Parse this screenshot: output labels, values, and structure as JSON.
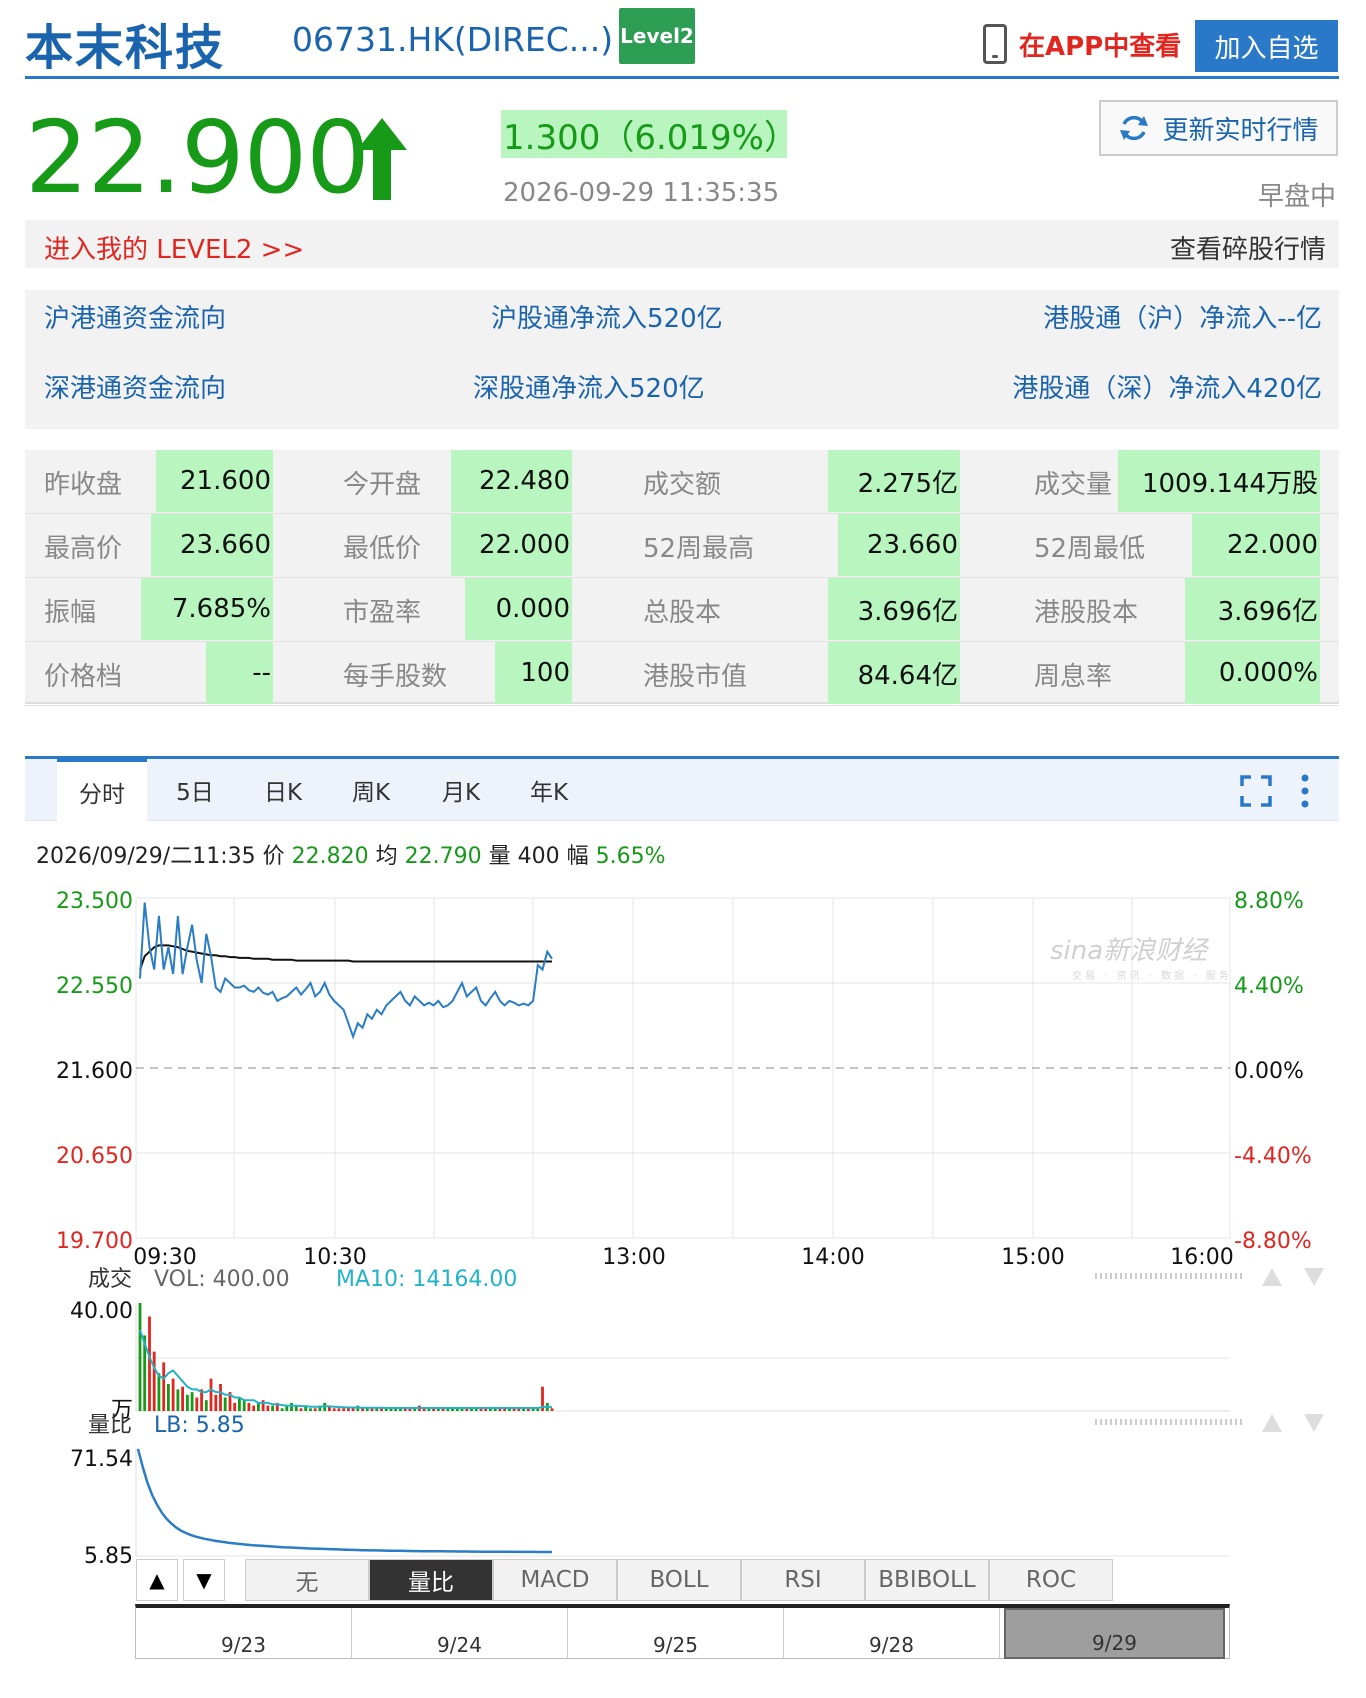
{
  "header": {
    "stock_name": "本末科技",
    "stock_code": "06731.HK(DIREC...)",
    "level2_badge": "Level2",
    "app_link": "在APP中查看",
    "add_fav": "加入自选"
  },
  "quote": {
    "price": "22.900",
    "change": "1.300（6.019%）",
    "timestamp": "2026-09-29 11:35:35",
    "refresh_label": "更新实时行情",
    "market_status": "早盘中",
    "level2_link": "进入我的 LEVEL2 >>",
    "odd_lot": "查看碎股行情"
  },
  "flows": {
    "sh_flow": "沪港通资金流向",
    "sh_north": "沪股通净流入520亿",
    "sh_south": "港股通（沪）净流入--亿",
    "sz_flow": "深港通资金流向",
    "sz_north": "深股通净流入520亿",
    "sz_south": "港股通（深）净流入420亿"
  },
  "stats": [
    [
      [
        "昨收盘",
        "21.600"
      ],
      [
        "今开盘",
        "22.480"
      ],
      [
        "成交额",
        "2.275亿"
      ],
      [
        "成交量",
        "1009.144万股"
      ]
    ],
    [
      [
        "最高价",
        "23.660"
      ],
      [
        "最低价",
        "22.000"
      ],
      [
        "52周最高",
        "23.660"
      ],
      [
        "52周最低",
        "22.000"
      ]
    ],
    [
      [
        "振幅",
        "7.685%"
      ],
      [
        "市盈率",
        "0.000"
      ],
      [
        "总股本",
        "3.696亿"
      ],
      [
        "港股股本",
        "3.696亿"
      ]
    ],
    [
      [
        "价格档",
        "--"
      ],
      [
        "每手股数",
        "100"
      ],
      [
        "港股市值",
        "84.64亿"
      ],
      [
        "周息率",
        "0.000%"
      ]
    ]
  ],
  "tabs": [
    "分时",
    "5日",
    "日K",
    "周K",
    "月K",
    "年K"
  ],
  "hover": {
    "date": "2026/09/29/二11:35",
    "price_label": "价",
    "price": "22.820",
    "avg_label": "均",
    "avg": "22.790",
    "vol_label": "量",
    "vol": "400",
    "amp_label": "幅",
    "amp": "5.65%"
  },
  "watermark": {
    "logo": "sina新浪财经",
    "sub": "交易 · 资讯 · 数据 · 服务"
  },
  "chart_data": {
    "type": "line",
    "y_left_ticks": [
      "23.500",
      "22.550",
      "21.600",
      "20.650",
      "19.700"
    ],
    "y_right_ticks": [
      "8.80%",
      "4.40%",
      "0.00%",
      "-4.40%",
      "-8.80%"
    ],
    "x_ticks": [
      "09:30",
      "10:30",
      "13:00",
      "14:00",
      "15:00",
      "16:00"
    ],
    "ylim": [
      19.7,
      23.5
    ],
    "prev_close": 21.6,
    "colors": {
      "price": "#2a7dc4",
      "avg": "#111111",
      "up": "#179a18",
      "down": "#e0261f"
    },
    "price_series": [
      22.6,
      23.45,
      22.95,
      22.7,
      23.3,
      22.7,
      22.95,
      22.65,
      23.3,
      22.65,
      22.95,
      23.2,
      22.8,
      22.55,
      23.1,
      22.85,
      22.5,
      22.45,
      22.6,
      22.55,
      22.5,
      22.5,
      22.52,
      22.47,
      22.45,
      22.5,
      22.44,
      22.42,
      22.45,
      22.35,
      22.38,
      22.4,
      22.45,
      22.5,
      22.42,
      22.48,
      22.55,
      22.4,
      22.45,
      22.55,
      22.42,
      22.35,
      22.3,
      22.25,
      22.1,
      21.95,
      22.1,
      22.05,
      22.2,
      22.15,
      22.25,
      22.2,
      22.3,
      22.35,
      22.4,
      22.45,
      22.35,
      22.3,
      22.4,
      22.35,
      22.3,
      22.33,
      22.3,
      22.35,
      22.28,
      22.3,
      22.35,
      22.45,
      22.55,
      22.4,
      22.45,
      22.5,
      22.35,
      22.3,
      22.38,
      22.45,
      22.35,
      22.3,
      22.35,
      22.33,
      22.3,
      22.32,
      22.3,
      22.35,
      22.75,
      22.7,
      22.9,
      22.82
    ],
    "avg_series": [
      22.7,
      22.85,
      22.9,
      22.95,
      22.97,
      22.97,
      22.97,
      22.96,
      22.95,
      22.93,
      22.91,
      22.9,
      22.89,
      22.88,
      22.87,
      22.86,
      22.86,
      22.85,
      22.85,
      22.84,
      22.84,
      22.83,
      22.83,
      22.83,
      22.82,
      22.82,
      22.82,
      22.82,
      22.81,
      22.81,
      22.81,
      22.81,
      22.81,
      22.8,
      22.8,
      22.8,
      22.8,
      22.8,
      22.8,
      22.8,
      22.8,
      22.8,
      22.8,
      22.8,
      22.8,
      22.79,
      22.79,
      22.79,
      22.79,
      22.79,
      22.79,
      22.79,
      22.79,
      22.79,
      22.79,
      22.79,
      22.79,
      22.79,
      22.79,
      22.79,
      22.79,
      22.79,
      22.79,
      22.79,
      22.79,
      22.79,
      22.79,
      22.79,
      22.79,
      22.79,
      22.79,
      22.79,
      22.79,
      22.79,
      22.79,
      22.79,
      22.79,
      22.79,
      22.79,
      22.79,
      22.79,
      22.79,
      22.79,
      22.79,
      22.79,
      22.79,
      22.79,
      22.79
    ],
    "volume": {
      "label": "成交",
      "vol_text": "VOL: 400.00",
      "ma_text": "MA10: 14164.00",
      "max_label": "40.00",
      "unit_label": "万",
      "max": 40,
      "bars": [
        40,
        28,
        35,
        22,
        14,
        18,
        10,
        12,
        8,
        9,
        6,
        7,
        5,
        8,
        4,
        12,
        6,
        10,
        5,
        7,
        3,
        5,
        4,
        3,
        2,
        3,
        4,
        2,
        2,
        3,
        1,
        2,
        3,
        2,
        1,
        2,
        1,
        1,
        2,
        3,
        2,
        1,
        1,
        1,
        1,
        1,
        2,
        1,
        1,
        1,
        1,
        1,
        1,
        1,
        1,
        1,
        1,
        1,
        1,
        2,
        1,
        1,
        1,
        1,
        1,
        1,
        1,
        1,
        1,
        1,
        1,
        1,
        1,
        1,
        1,
        1,
        1,
        1,
        1,
        1,
        1,
        1,
        1,
        1,
        1,
        9,
        3,
        1
      ],
      "ma": [
        30,
        25,
        20,
        16,
        13,
        12,
        14,
        15,
        13,
        11,
        9,
        8,
        8,
        7,
        7,
        8,
        7,
        7,
        6,
        6,
        5,
        5,
        4,
        4,
        4,
        3,
        3,
        3,
        2.5,
        2.5,
        2.2,
        2,
        2,
        2,
        1.8,
        1.8,
        1.6,
        1.6,
        1.6,
        1.8,
        1.7,
        1.6,
        1.5,
        1.4,
        1.3,
        1.3,
        1.3,
        1.2,
        1.2,
        1.2,
        1.2,
        1.2,
        1.1,
        1.1,
        1.1,
        1.1,
        1.1,
        1.1,
        1.1,
        1.1,
        1.1,
        1.1,
        1.1,
        1.1,
        1.1,
        1.1,
        1.1,
        1.1,
        1.1,
        1.1,
        1.1,
        1.1,
        1.1,
        1.1,
        1.1,
        1.1,
        1.1,
        1.1,
        1.1,
        1.1,
        1.1,
        1.1,
        1.1,
        1.1,
        1.1,
        1.5,
        1.6,
        1.4
      ]
    },
    "ratio": {
      "label": "量比",
      "lb_text": "LB: 5.85",
      "max_label": "71.54",
      "min_label": "5.85",
      "max": 71.54,
      "min": 5.85,
      "series": [
        71.54,
        60,
        50,
        42,
        36,
        31,
        27,
        24,
        21.5,
        19.5,
        18,
        16.8,
        15.8,
        15,
        14.3,
        13.7,
        13.1,
        12.6,
        12.2,
        11.8,
        11.4,
        11.1,
        10.8,
        10.5,
        10.2,
        10,
        9.8,
        9.6,
        9.4,
        9.2,
        9.0,
        8.8,
        8.7,
        8.5,
        8.4,
        8.2,
        8.1,
        8.0,
        7.9,
        7.8,
        7.7,
        7.6,
        7.5,
        7.4,
        7.3,
        7.2,
        7.1,
        7.0,
        6.95,
        6.9,
        6.85,
        6.8,
        6.75,
        6.7,
        6.65,
        6.6,
        6.55,
        6.5,
        6.45,
        6.4,
        6.38,
        6.35,
        6.32,
        6.3,
        6.27,
        6.25,
        6.22,
        6.2,
        6.17,
        6.15,
        6.12,
        6.1,
        6.07,
        6.05,
        6.03,
        6.01,
        6.0,
        5.98,
        5.96,
        5.94,
        5.92,
        5.91,
        5.9,
        5.89,
        5.88,
        5.87,
        5.86,
        5.85
      ]
    }
  },
  "indicators": [
    "无",
    "量比",
    "MACD",
    "BOLL",
    "RSI",
    "BBIBOLL",
    "ROC"
  ],
  "active_indicator": "量比",
  "nav": {
    "up": "▲",
    "down": "▼"
  },
  "timeline": [
    "9/23",
    "9/24",
    "9/25",
    "9/28",
    "9/29"
  ]
}
